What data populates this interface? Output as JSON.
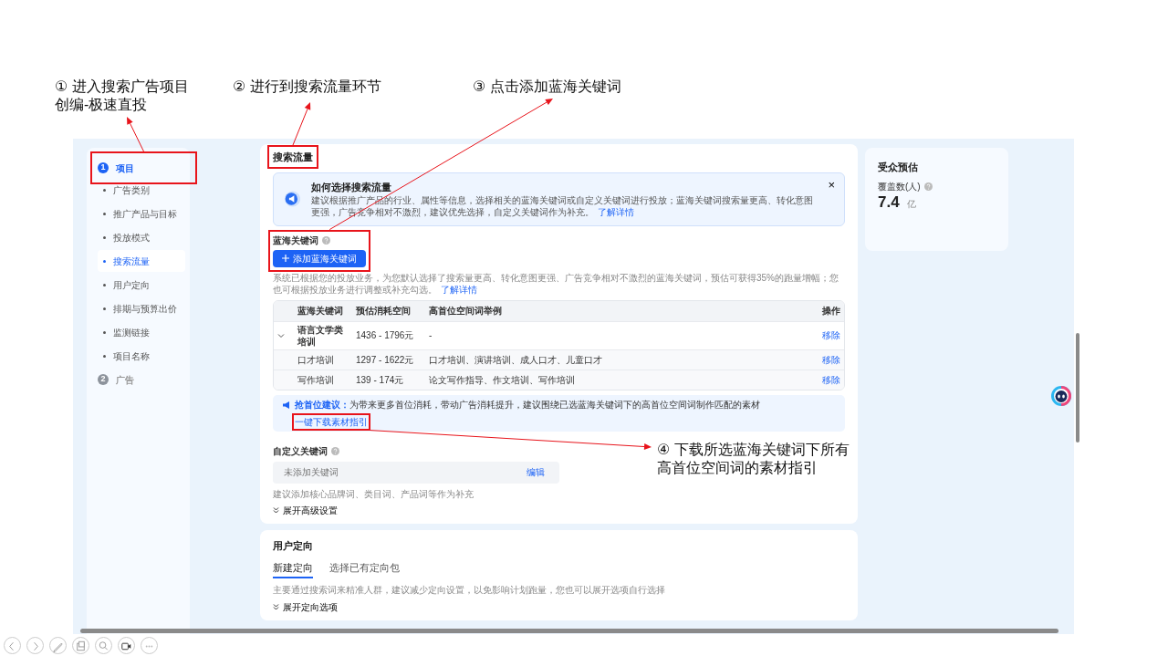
{
  "annotations": [
    {
      "lines": [
        "① 进入搜索广告项目",
        "创编-极速直投"
      ]
    },
    {
      "lines": [
        "② 进行到搜索流量环节"
      ]
    },
    {
      "lines": [
        "③ 点击添加蓝海关键词"
      ]
    },
    {
      "lines": [
        "④ 下载所选蓝海关键词下所有",
        "高首位空间词的素材指引"
      ]
    }
  ],
  "sidebar": {
    "steps": [
      {
        "number": "1",
        "label": "项目",
        "active": true,
        "items": [
          {
            "label": "广告类别",
            "selected": false
          },
          {
            "label": "推广产品与目标",
            "selected": false
          },
          {
            "label": "投放模式",
            "selected": false
          },
          {
            "label": "搜索流量",
            "selected": true
          },
          {
            "label": "用户定向",
            "selected": false
          },
          {
            "label": "排期与预算出价",
            "selected": false
          },
          {
            "label": "监测链接",
            "selected": false
          },
          {
            "label": "项目名称",
            "selected": false
          }
        ]
      },
      {
        "number": "2",
        "label": "广告",
        "active": false
      }
    ]
  },
  "search_traffic": {
    "title": "搜索流量",
    "notice": {
      "title": "如何选择搜索流量",
      "body": "建议根据推广产品的行业、属性等信息，选择相关的蓝海关键词或自定义关键词进行投放；蓝海关键词搜索量更高、转化意图更强，广告竞争相对不激烈，建议优先选择，自定义关键词作为补充。",
      "link": "了解详情",
      "close": "×"
    },
    "blue_sea": {
      "label": "蓝海关键词",
      "button": "添加蓝海关键词",
      "description": "系统已根据您的投放业务，为您默认选择了搜索量更高、转化意图更强、广告竞争相对不激烈的蓝海关键词，预估可获得35%的跑量增幅；您也可根据投放业务进行调整或补充勾选。",
      "link": "了解详情"
    },
    "table": {
      "columns": [
        "蓝海关键词",
        "预估消耗空间",
        "高首位空间词举例",
        "操作"
      ],
      "rows": [
        {
          "keyword": "语言文学类培训",
          "cost": "1436 - 1796元",
          "examples": "-",
          "action": "移除",
          "expanded": true,
          "children": [
            {
              "keyword": "口才培训",
              "cost": "1297 - 1622元",
              "examples": "口才培训、演讲培训、成人口才、儿童口才",
              "action": "移除"
            },
            {
              "keyword": "写作培训",
              "cost": "139 - 174元",
              "examples": "论文写作指导、作文培训、写作培训",
              "action": "移除"
            }
          ]
        }
      ]
    },
    "tip": {
      "label": "抢首位建议：",
      "text": "为带来更多首位消耗，带动广告消耗提升，建议围绕已选蓝海关键词下的高首位空间词制作匹配的素材",
      "link": "一键下载素材指引"
    },
    "custom": {
      "label": "自定义关键词",
      "placeholder": "未添加关键词",
      "edit": "编辑",
      "hint": "建议添加核心品牌词、类目词、产品词等作为补充"
    },
    "advanced": "展开高级设置"
  },
  "targeting": {
    "title": "用户定向",
    "tabs": [
      {
        "label": "新建定向",
        "selected": true
      },
      {
        "label": "选择已有定向包",
        "selected": false
      }
    ],
    "hint": "主要通过搜索词来精准人群，建议减少定向设置，以免影响计划跑量，您也可以展开选项自行选择",
    "expand": "展开定向选项"
  },
  "audience": {
    "title": "受众预估",
    "label": "覆盖数(人)",
    "value": "7.4",
    "unit": "亿"
  }
}
